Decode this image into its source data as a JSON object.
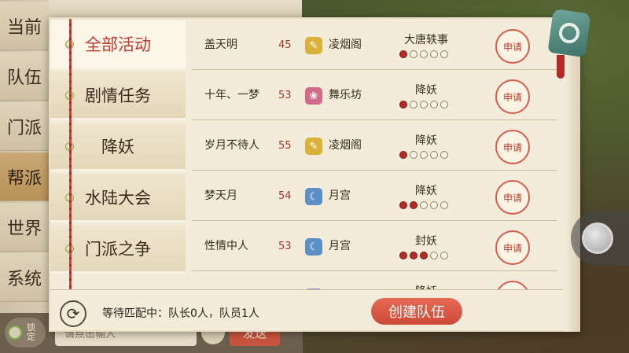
{
  "channels": [
    {
      "label": "当前",
      "active": false
    },
    {
      "label": "队伍",
      "active": false
    },
    {
      "label": "门派",
      "active": false
    },
    {
      "label": "帮派",
      "active": true
    },
    {
      "label": "世界",
      "active": false
    },
    {
      "label": "系统",
      "active": false
    }
  ],
  "chat": {
    "lock_label": "锁定",
    "input_placeholder": "请点击输入",
    "send_label": "发送"
  },
  "categories": [
    {
      "label": "全部活动",
      "active": true
    },
    {
      "label": "剧情任务",
      "active": false
    },
    {
      "label": "降妖",
      "active": false
    },
    {
      "label": "水陆大会",
      "active": false
    },
    {
      "label": "门派之争",
      "active": false
    }
  ],
  "rows": [
    {
      "name": "盖天明",
      "level": "45",
      "sect": "凌烟阁",
      "sect_icon": "scroll-icon",
      "sect_color": "#d9b23a",
      "activity": "大唐轶事",
      "filled": 1,
      "apply": "申请"
    },
    {
      "name": "十年、一梦",
      "level": "53",
      "sect": "舞乐坊",
      "sect_icon": "fan-icon",
      "sect_color": "#d46a8a",
      "activity": "降妖",
      "filled": 1,
      "apply": "申请"
    },
    {
      "name": "岁月不待人",
      "level": "55",
      "sect": "凌烟阁",
      "sect_icon": "scroll-icon",
      "sect_color": "#d9b23a",
      "activity": "降妖",
      "filled": 1,
      "apply": "申请"
    },
    {
      "name": "梦天月",
      "level": "54",
      "sect": "月宫",
      "sect_icon": "moon-icon",
      "sect_color": "#5b8fc6",
      "activity": "降妖",
      "filled": 2,
      "apply": "申请"
    },
    {
      "name": "性情中人",
      "level": "53",
      "sect": "月宫",
      "sect_icon": "moon-icon",
      "sect_color": "#5b8fc6",
      "activity": "封妖",
      "filled": 3,
      "apply": "申请"
    },
    {
      "name": "",
      "level": "",
      "sect": "",
      "sect_icon": "flower-icon",
      "sect_color": "#9a7ac0",
      "activity": "降妖",
      "filled": 0,
      "apply": ""
    }
  ],
  "dots_total": 5,
  "footer": {
    "status": "等待匹配中：队长0人，队员1人",
    "create_button": "创建队伍"
  },
  "icons": {
    "refresh": "refresh-icon",
    "close": "close-pendant-icon",
    "joystick": "joystick-icon"
  }
}
